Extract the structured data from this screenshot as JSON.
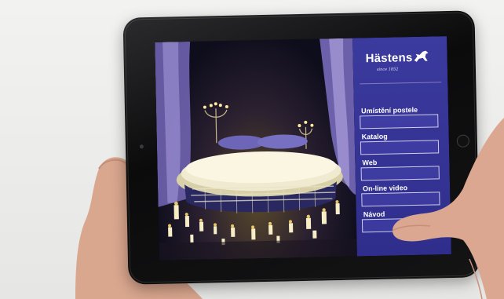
{
  "brand": {
    "name": "Hästens",
    "tagline": "since 1852"
  },
  "menu": {
    "items": [
      {
        "label": "Umístění postele"
      },
      {
        "label": "Katalog"
      },
      {
        "label": "Web"
      },
      {
        "label": "On-line video"
      },
      {
        "label": "Návod"
      }
    ]
  },
  "colors": {
    "panel": "#3b3a9e",
    "tablet": "#111112",
    "backdrop": "#ececeb"
  }
}
